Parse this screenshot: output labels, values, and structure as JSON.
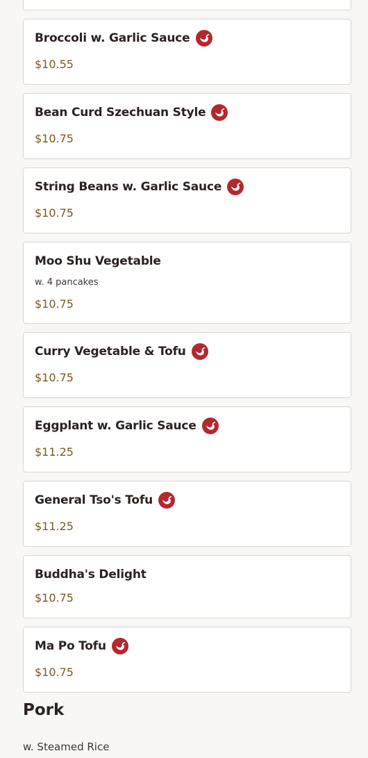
{
  "items": [
    {
      "name": "Broccoli w. Garlic Sauce",
      "price": "$10.55",
      "spicy": true
    },
    {
      "name": "Bean Curd Szechuan Style",
      "price": "$10.75",
      "spicy": true
    },
    {
      "name": "String Beans w. Garlic Sauce",
      "price": "$10.75",
      "spicy": true
    },
    {
      "name": "Moo Shu Vegetable",
      "description": "w. 4 pancakes",
      "price": "$10.75",
      "spicy": false
    },
    {
      "name": "Curry Vegetable & Tofu",
      "price": "$10.75",
      "spicy": true
    },
    {
      "name": "Eggplant w. Garlic Sauce",
      "price": "$11.25",
      "spicy": true
    },
    {
      "name": "General Tso's Tofu",
      "price": "$11.25",
      "spicy": true
    },
    {
      "name": "Buddha's Delight",
      "price": "$10.75",
      "spicy": false
    },
    {
      "name": "Ma Po Tofu",
      "price": "$10.75",
      "spicy": true
    }
  ],
  "section": {
    "title": "Pork",
    "subtitle": "w. Steamed Rice"
  },
  "icons": {
    "spicy": "chili-pepper-icon"
  },
  "colors": {
    "spicy_badge": "#b3282d",
    "price": "#7a5a1f",
    "card_border": "#d9d4d0"
  }
}
